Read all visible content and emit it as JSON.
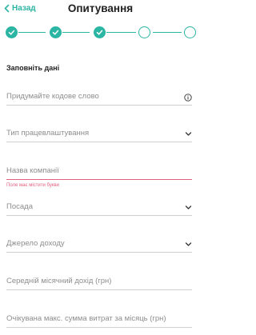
{
  "header": {
    "back_label": "Назад",
    "title": "Опитування"
  },
  "stepper": {
    "steps": [
      {
        "state": "done"
      },
      {
        "state": "done"
      },
      {
        "state": "done"
      },
      {
        "state": "todo"
      },
      {
        "state": "todo"
      }
    ]
  },
  "colors": {
    "accent": "#2bb5a3",
    "error": "#e0607e",
    "placeholder": "#8d8d8d",
    "divider": "#cfcfcf"
  },
  "form": {
    "section_title": "Заповніть дані",
    "fields": [
      {
        "placeholder": "Придумайте кодове слово",
        "value": "",
        "icon": "info-icon"
      },
      {
        "placeholder": "Тип працевлаштування",
        "value": "",
        "icon": "chevron-down-icon"
      },
      {
        "placeholder": "Назва компанії",
        "value": "",
        "error": "Поле має містити букви"
      },
      {
        "placeholder": "Посада",
        "value": "",
        "icon": "chevron-down-icon"
      },
      {
        "placeholder": "Джерело доходу",
        "value": "",
        "icon": "chevron-down-icon"
      },
      {
        "placeholder": "Середній місячний дохід (грн)",
        "value": ""
      },
      {
        "placeholder": "Очікувана макс. сумма витрат за місяць (грн)",
        "value": ""
      }
    ]
  }
}
